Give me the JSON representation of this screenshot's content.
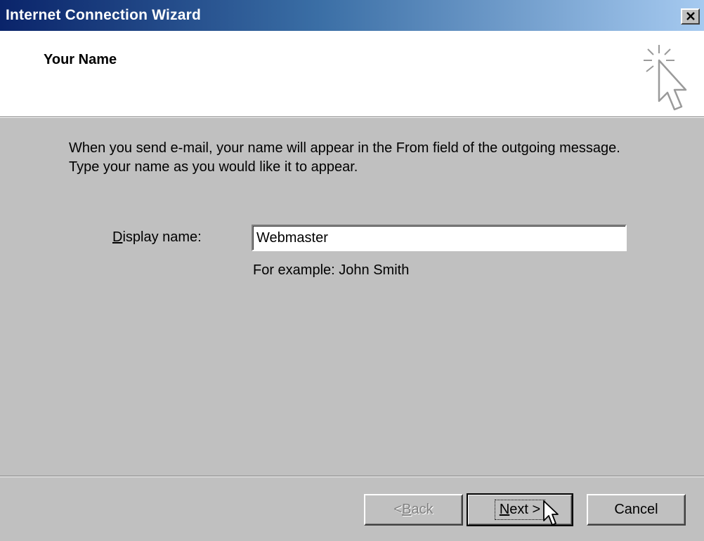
{
  "window": {
    "title": "Internet Connection Wizard",
    "close_icon": "close-icon"
  },
  "header": {
    "title": "Your Name",
    "icon": "wizard-sparkle-cursor-icon"
  },
  "body": {
    "description_line1": "When you send e-mail, your name will appear in the From field of the outgoing message.",
    "description_line2": "Type your name as you would like it to appear."
  },
  "form": {
    "display_name_label_accesskey": "D",
    "display_name_label_rest": "isplay name:",
    "display_name_value": "Webmaster",
    "example_text": "For example: John Smith"
  },
  "buttons": {
    "back_prefix": "< ",
    "back_accesskey": "B",
    "back_rest": "ack",
    "next_accesskey": "N",
    "next_rest": "ext >",
    "cancel": "Cancel"
  }
}
